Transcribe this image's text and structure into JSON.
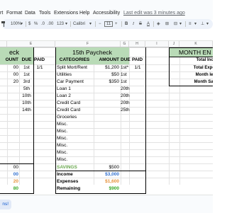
{
  "menu": {
    "items": [
      "rt",
      "Format",
      "Data",
      "Tools",
      "Extensions",
      "Help",
      "Accessibility"
    ],
    "last_edit": "Last edit was 3 minutes ago"
  },
  "toolbar": {
    "paint_format_icon": "paint-format-icon",
    "zoom": "100%",
    "currency": "$",
    "percent": "%",
    "decrease_decimal": ".0",
    "increase_decimal": ".00",
    "number_format": "123",
    "font": "Calibri",
    "font_size": "11",
    "colors": {
      "accent": "#0b57d0",
      "header_green": "#b9dbb7",
      "income_blue": "#2f6fcf",
      "expense_orange": "#e69138",
      "remaining_green": "#38a827",
      "savings_green": "#6aa84f"
    }
  },
  "columns": [
    "E",
    "F",
    "G",
    "H",
    "I",
    "J",
    "K"
  ],
  "left_section": {
    "title": "eck",
    "headers": {
      "amount": "OUNT",
      "due": "DUE",
      "paid": "PAID"
    },
    "rows": [
      {
        "amount": "00",
        "due": "1st",
        "paid": "1/1"
      },
      {
        "amount": "00",
        "due": "1st",
        "paid": ""
      },
      {
        "amount": "20",
        "due": "3rd",
        "paid": ""
      },
      {
        "amount": "",
        "due": "5th",
        "paid": ""
      },
      {
        "amount": "",
        "due": "10th",
        "paid": ""
      },
      {
        "amount": "",
        "due": "10th",
        "paid": ""
      },
      {
        "amount": "",
        "due": "14th",
        "paid": ""
      }
    ],
    "savings": "00",
    "income": "00",
    "expenses": "20",
    "remaining": "80"
  },
  "paycheck": {
    "title": "15th Paycheck",
    "headers": {
      "category": "CATEGORIES",
      "amount": "AMOUNT",
      "due": "DUE",
      "paid": "PAID"
    },
    "rows": [
      {
        "category": "Split Mort/Rent",
        "amount": "$1,200",
        "due": "1st*",
        "paid": "1/1"
      },
      {
        "category": "Utilities",
        "amount": "$50",
        "due": "1st",
        "paid": ""
      },
      {
        "category": "Car Payment",
        "amount": "$350",
        "due": "1st",
        "paid": ""
      },
      {
        "category": "Loan 1",
        "amount": "",
        "due": "20th",
        "paid": ""
      },
      {
        "category": "Loan 2",
        "amount": "",
        "due": "20th",
        "paid": ""
      },
      {
        "category": "Credit Card",
        "amount": "",
        "due": "20th",
        "paid": ""
      },
      {
        "category": "Credit Card",
        "amount": "",
        "due": "25th",
        "paid": ""
      },
      {
        "category": "Groceries",
        "amount": "",
        "due": "",
        "paid": ""
      },
      {
        "category": "Misc.",
        "amount": "",
        "due": "",
        "paid": ""
      },
      {
        "category": "Misc.",
        "amount": "",
        "due": "",
        "paid": ""
      },
      {
        "category": "Misc.",
        "amount": "",
        "due": "",
        "paid": ""
      },
      {
        "category": "Misc.",
        "amount": "",
        "due": "",
        "paid": ""
      },
      {
        "category": "Misc.",
        "amount": "",
        "due": "",
        "paid": ""
      },
      {
        "category": "Misc.",
        "amount": "",
        "due": "",
        "paid": ""
      }
    ],
    "savings_label": "SAVINGS",
    "savings_value": "$500",
    "income_label": "Income",
    "income_value": "$3,000",
    "expenses_label": "Expenses",
    "expenses_value": "$1,600",
    "remaining_label": "Remaining",
    "remaining_value": "$900"
  },
  "month_end": {
    "title": "MONTH EN",
    "rows": [
      "Total Income",
      "Total Expense",
      "Month left ov",
      "Month Saving"
    ]
  },
  "sheet_tab": "ns!"
}
